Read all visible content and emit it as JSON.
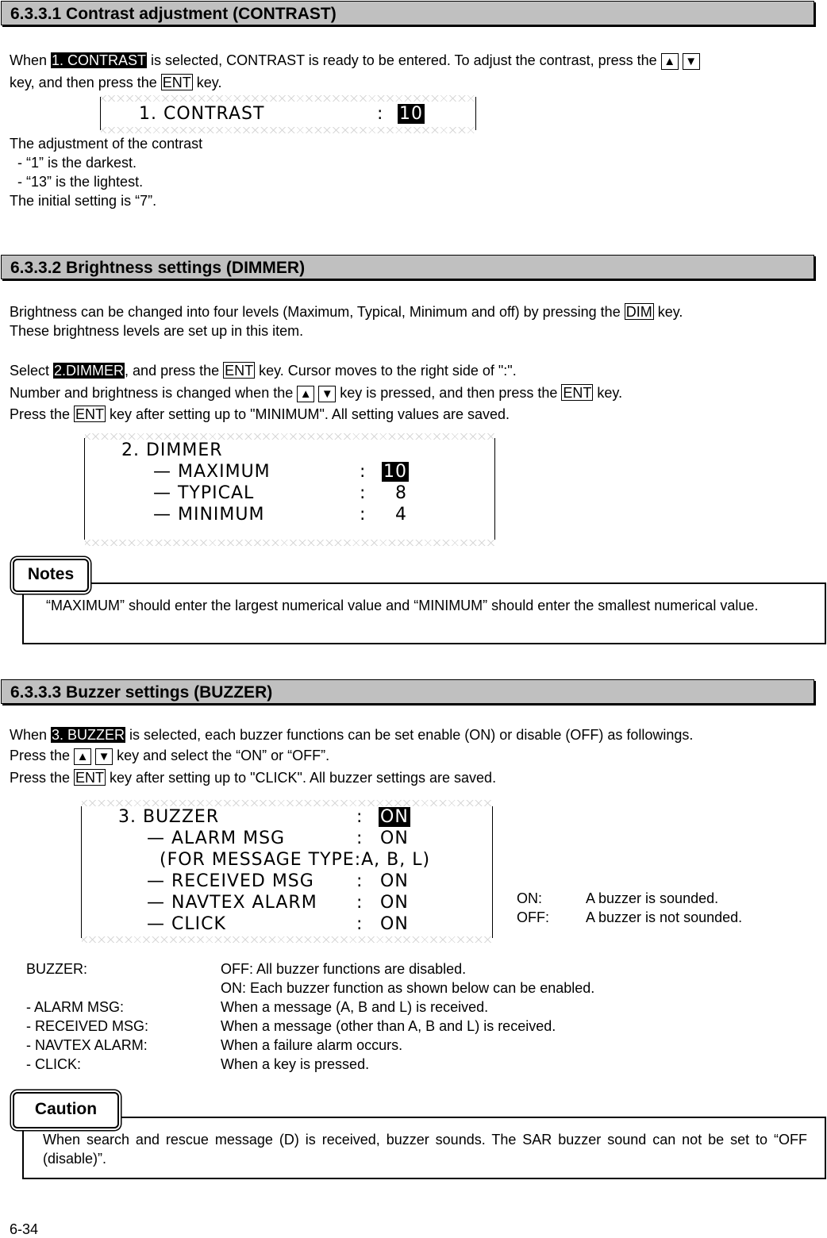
{
  "sections": {
    "contrast": {
      "title": "6.3.3.1 Contrast adjustment (CONTRAST)",
      "intro_prefix": "When ",
      "intro_highlight": "1. CONTRAST",
      "intro_mid": " is selected, CONTRAST is ready to be entered. To adjust the contrast, press the ",
      "intro_line2_prefix": "key, and then press the ",
      "intro_line2_key": "ENT",
      "intro_line2_suffix": " key.",
      "lcd": {
        "label": "1. CONTRAST",
        "colon": ":",
        "value": "10"
      },
      "notes": [
        "The adjustment of the contrast",
        "  - “1” is the darkest.",
        "  - “13” is the lightest.",
        "The initial setting is “7”."
      ]
    },
    "dimmer": {
      "title": "6.3.3.2 Brightness settings (DIMMER)",
      "para1_line1_prefix": "Brightness can be changed into four levels (Maximum, Typical, Minimum and off) by pressing the ",
      "para1_line1_key": "DIM",
      "para1_line1_suffix": " key.",
      "para1_line2": "These brightness levels are set up in this item.",
      "select_prefix": "Select ",
      "select_highlight": "2.DIMMER",
      "select_mid": ", and press the ",
      "select_key": "ENT",
      "select_suffix": " key. Cursor moves to the right side of \":\".",
      "number_prefix": "Number and brightness is changed when the ",
      "number_mid": " key is pressed, and then press the ",
      "number_key": "ENT",
      "number_suffix": " key.",
      "press_prefix": "Press the ",
      "press_key": "ENT",
      "press_suffix": " key after setting up to \"MINIMUM\". All setting values are saved.",
      "lcd": {
        "header": "2. DIMMER",
        "rows": [
          {
            "label": "— MAXIMUM",
            "colon": ":",
            "value": "10"
          },
          {
            "label": "— TYPICAL",
            "colon": ":",
            "value": "8"
          },
          {
            "label": "— MINIMUM",
            "colon": ":",
            "value": "4"
          }
        ]
      },
      "notes_label": "Notes",
      "notes_text": "“MAXIMUM” should enter the largest numerical value and “MINIMUM” should enter the smallest numerical value."
    },
    "buzzer": {
      "title": "6.3.3.3 Buzzer settings (BUZZER)",
      "intro_prefix": "When ",
      "intro_highlight": "3. BUZZER",
      "intro_suffix": " is selected, each buzzer functions can be set enable (ON) or disable (OFF) as followings.",
      "press1_prefix": "Press the ",
      "press1_suffix": " key and select the “ON” or “OFF”.",
      "press2_prefix": "Press the ",
      "press2_key": "ENT",
      "press2_suffix": " key after setting up to \"CLICK\". All buzzer settings are saved.",
      "lcd": {
        "header": {
          "label": "3. BUZZER",
          "colon": ":",
          "value": "ON"
        },
        "rows": [
          {
            "label": "— ALARM MSG",
            "colon": ":",
            "value": "ON"
          },
          {
            "label": "  (FOR MESSAGE TYPE:A, B, L)",
            "colon": "",
            "value": ""
          },
          {
            "label": "— RECEIVED MSG",
            "colon": ":",
            "value": "ON"
          },
          {
            "label": "— NAVTEX ALARM",
            "colon": ":",
            "value": "ON"
          },
          {
            "label": "— CLICK",
            "colon": ":",
            "value": "ON"
          }
        ]
      },
      "legend": [
        {
          "term": "ON:",
          "desc": "A buzzer is sounded."
        },
        {
          "term": "OFF:",
          "desc": "A buzzer is not sounded."
        }
      ],
      "descriptions": [
        {
          "term": "BUZZER:",
          "desc": "OFF: All buzzer functions are disabled."
        },
        {
          "term": "",
          "desc": "ON: Each buzzer function as shown below can be enabled."
        },
        {
          "term": "- ALARM MSG:",
          "desc": "When a message (A, B and L) is received."
        },
        {
          "term": "- RECEIVED MSG:",
          "desc": "When a message (other than A, B and L) is received."
        },
        {
          "term": "- NAVTEX ALARM:",
          "desc": "When a failure alarm occurs."
        },
        {
          "term": "- CLICK:",
          "desc": "When a key is pressed."
        }
      ],
      "caution_label": "Caution",
      "caution_text": "When search and rescue message (D) is received, buzzer sounds. The SAR buzzer sound can not be set to “OFF (disable)”."
    }
  },
  "keys": {
    "up": "▲",
    "down": "▼"
  },
  "page_number": "6-34"
}
